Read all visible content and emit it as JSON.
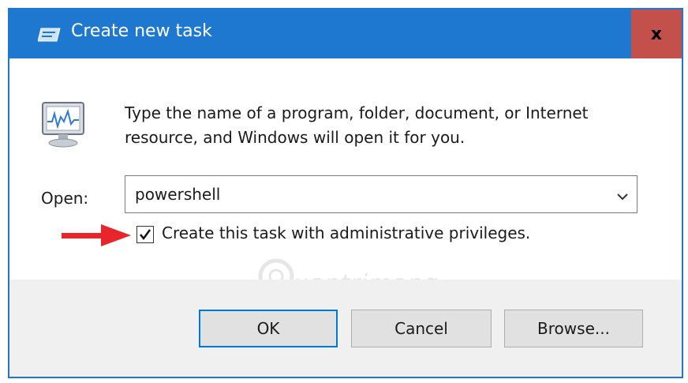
{
  "window": {
    "title": "Create new task",
    "close_label": "x"
  },
  "dialog": {
    "description": "Type the name of a program, folder, document, or Internet resource, and Windows will open it for you.",
    "open_label": "Open:",
    "open_value": "powershell",
    "admin_checkbox_label": "Create this task with administrative privileges.",
    "admin_checkbox_checked": true
  },
  "buttons": {
    "ok": "OK",
    "cancel": "Cancel",
    "browse": "Browse..."
  },
  "watermark": {
    "text": "uantrimang"
  },
  "colors": {
    "titlebar": "#1e78d0",
    "close_button": "#c4504b",
    "annotation_arrow": "#e8252a",
    "footer": "#f0f0f0"
  }
}
